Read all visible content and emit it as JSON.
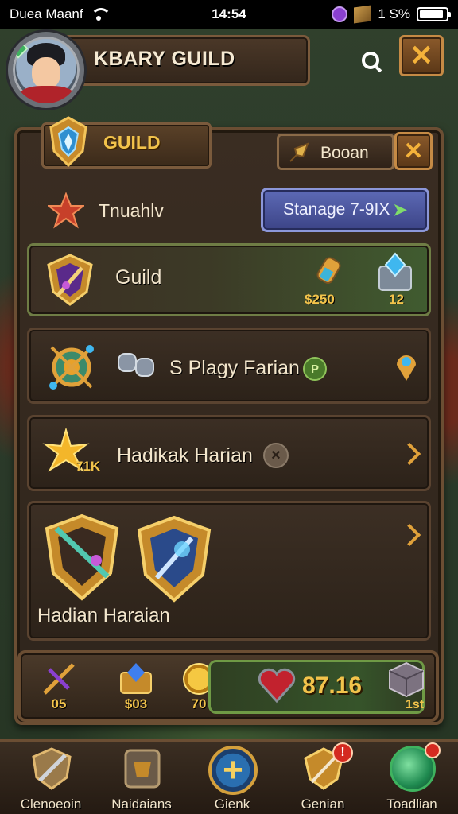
{
  "status_bar": {
    "carrier": "Duea Maanf",
    "time": "14:54",
    "battery": "1 S%",
    "battery_level": 0.9
  },
  "header": {
    "title": "KBARY GUILD",
    "close_label": "✕"
  },
  "panel": {
    "tab_label": "GUILD",
    "boost_label": "Booan",
    "close_label": "✕",
    "rank_label": "Tnuahlv",
    "stage_button": "Stanage 7-9IX"
  },
  "rows": [
    {
      "label": "Guild",
      "value_a": "$250",
      "value_b": "12"
    },
    {
      "label": "S Plagy Farian",
      "badge": "P"
    },
    {
      "label": "Hadikak Harian",
      "icon_value": "71K",
      "badge": "✕"
    },
    {
      "label": "Hadian Haraian"
    }
  ],
  "resources": {
    "items": [
      {
        "value": "05"
      },
      {
        "value": "$03"
      },
      {
        "value": "70"
      }
    ],
    "main_value": "87.16",
    "rank": "1st"
  },
  "nav": {
    "items": [
      {
        "label": "Clenoeoin"
      },
      {
        "label": "Naidaians"
      },
      {
        "label": "Gienk"
      },
      {
        "label": "Genian",
        "badge": "!"
      },
      {
        "label": "Toadlian"
      }
    ]
  },
  "colors": {
    "accent_gold": "#f2c34b",
    "wood_dark": "#2f251c",
    "wood_border": "#6b4e33",
    "stage_blue": "#4d59a8",
    "highlight_green": "#6f9a45"
  }
}
